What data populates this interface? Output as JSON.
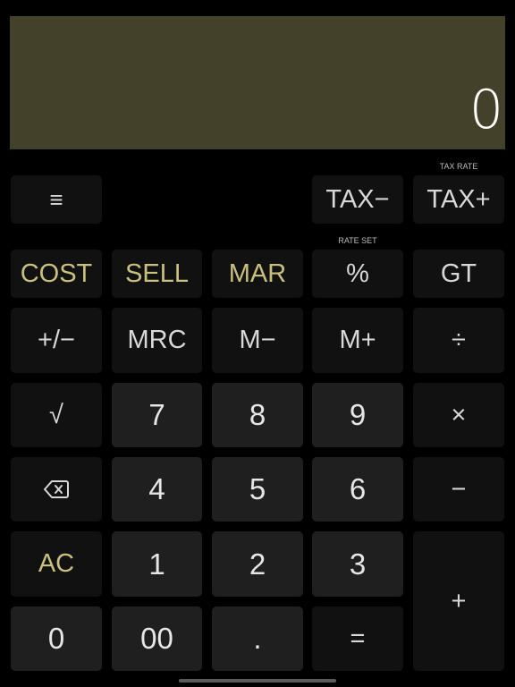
{
  "display": {
    "value": "0",
    "background": "#43412a"
  },
  "captions": {
    "tax_rate": "TAX RATE",
    "rate_set": "RATE SET"
  },
  "keys": {
    "menu": "≡",
    "tax_minus": "TAX−",
    "tax_plus": "TAX+",
    "cost": "COST",
    "sell": "SELL",
    "mar": "MAR",
    "percent": "%",
    "gt": "GT",
    "plus_minus": "+/−",
    "mrc": "MRC",
    "m_minus": "M−",
    "m_plus": "M+",
    "divide": "÷",
    "sqrt": "√",
    "seven": "7",
    "eight": "8",
    "nine": "9",
    "multiply": "×",
    "four": "4",
    "five": "5",
    "six": "6",
    "minus": "−",
    "ac": "AC",
    "one": "1",
    "two": "2",
    "three": "3",
    "plus": "+",
    "zero": "0",
    "double_zero": "00",
    "decimal": ".",
    "equals": "="
  },
  "colors": {
    "accent_gold": "#c9c07d",
    "key_dark": "#111111",
    "key_number": "#1f1f1f"
  }
}
